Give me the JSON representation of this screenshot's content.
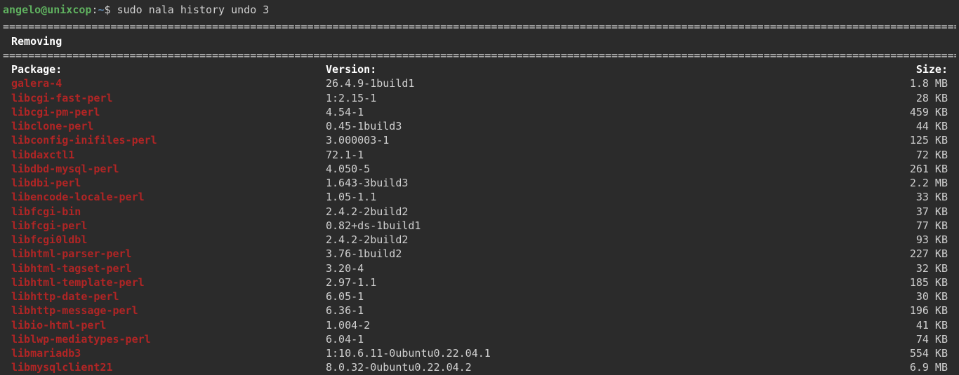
{
  "prompt": {
    "user_host": "angelo@unixcop",
    "separator": ":",
    "path": "~",
    "symbol": "$",
    "command": "sudo nala history undo 3"
  },
  "separator_line": "=======================================================================================================================================================================",
  "section_title": "Removing",
  "headers": {
    "package": "Package:",
    "version": "Version:",
    "size": "Size:"
  },
  "packages": [
    {
      "name": "galera-4",
      "version": "26.4.9-1build1",
      "size": "1.8 MB"
    },
    {
      "name": "libcgi-fast-perl",
      "version": "1:2.15-1",
      "size": "28 KB"
    },
    {
      "name": "libcgi-pm-perl",
      "version": "4.54-1",
      "size": "459 KB"
    },
    {
      "name": "libclone-perl",
      "version": "0.45-1build3",
      "size": "44 KB"
    },
    {
      "name": "libconfig-inifiles-perl",
      "version": "3.000003-1",
      "size": "125 KB"
    },
    {
      "name": "libdaxctl1",
      "version": "72.1-1",
      "size": "72 KB"
    },
    {
      "name": "libdbd-mysql-perl",
      "version": "4.050-5",
      "size": "261 KB"
    },
    {
      "name": "libdbi-perl",
      "version": "1.643-3build3",
      "size": "2.2 MB"
    },
    {
      "name": "libencode-locale-perl",
      "version": "1.05-1.1",
      "size": "33 KB"
    },
    {
      "name": "libfcgi-bin",
      "version": "2.4.2-2build2",
      "size": "37 KB"
    },
    {
      "name": "libfcgi-perl",
      "version": "0.82+ds-1build1",
      "size": "77 KB"
    },
    {
      "name": "libfcgi0ldbl",
      "version": "2.4.2-2build2",
      "size": "93 KB"
    },
    {
      "name": "libhtml-parser-perl",
      "version": "3.76-1build2",
      "size": "227 KB"
    },
    {
      "name": "libhtml-tagset-perl",
      "version": "3.20-4",
      "size": "32 KB"
    },
    {
      "name": "libhtml-template-perl",
      "version": "2.97-1.1",
      "size": "185 KB"
    },
    {
      "name": "libhttp-date-perl",
      "version": "6.05-1",
      "size": "30 KB"
    },
    {
      "name": "libhttp-message-perl",
      "version": "6.36-1",
      "size": "196 KB"
    },
    {
      "name": "libio-html-perl",
      "version": "1.004-2",
      "size": "41 KB"
    },
    {
      "name": "liblwp-mediatypes-perl",
      "version": "6.04-1",
      "size": "74 KB"
    },
    {
      "name": "libmariadb3",
      "version": "1:10.6.11-0ubuntu0.22.04.1",
      "size": "554 KB"
    },
    {
      "name": "libmysqlclient21",
      "version": "8.0.32-0ubuntu0.22.04.2",
      "size": "6.9 MB"
    }
  ]
}
